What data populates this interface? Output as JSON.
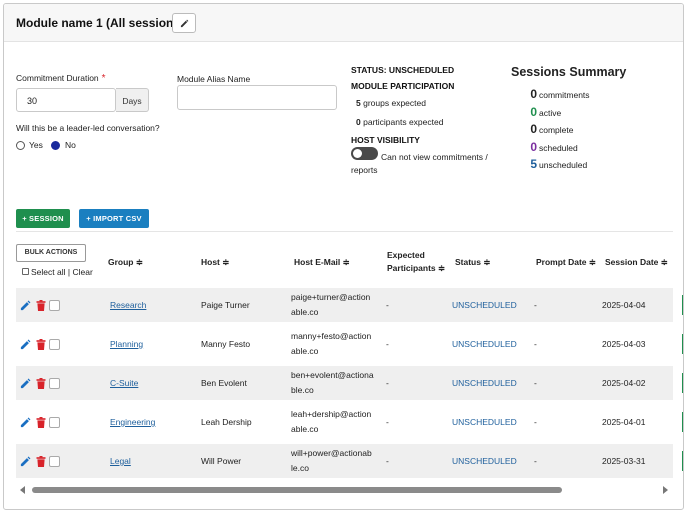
{
  "header": {
    "title": "Module name 1 (All sessions )"
  },
  "form": {
    "commitment_duration_label": "Commitment Duration",
    "required_mark": "*",
    "commitment_duration_value": "30",
    "days_label": "Days",
    "alias_label": "Module Alias Name",
    "alias_value": "",
    "leader_question": "Will this be a leader-led conversation?",
    "yes_label": "Yes",
    "no_label": "No",
    "leader_led_selected": "No"
  },
  "status_panel": {
    "status": "STATUS: UNSCHEDULED",
    "participation_title": "MODULE PARTICIPATION",
    "groups_count": "5",
    "groups_label": "groups expected",
    "participants_count": "0",
    "participants_label": "participants expected",
    "host_visibility_title": "HOST VISIBILITY",
    "host_visibility_line1": "Can not view commitments /",
    "host_visibility_line2": "reports",
    "host_visibility_on": false
  },
  "summary": {
    "title": "Sessions Summary",
    "items": [
      {
        "count": "0",
        "label": "commitments",
        "color": "#222222"
      },
      {
        "count": "0",
        "label": "active",
        "color": "#1f8f4e"
      },
      {
        "count": "0",
        "label": "complete",
        "color": "#222222"
      },
      {
        "count": "0",
        "label": "scheduled",
        "color": "#7b2fa0"
      },
      {
        "count": "5",
        "label": "unscheduled",
        "color": "#1e5f9c"
      }
    ]
  },
  "actions": {
    "add_session": "+ SESSION",
    "import_csv": "+ IMPORT CSV",
    "bulk_actions": "BULK ACTIONS",
    "select_all": "Select all",
    "separator": "|",
    "clear": "Clear"
  },
  "table": {
    "headers": {
      "group": "Group ≑",
      "host": "Host ≑",
      "host_email": "Host E-Mail ≑",
      "expected_line1": "Expected",
      "expected_line2": "Participants ≑",
      "status": "Status ≑",
      "prompt_date": "Prompt Date ≑",
      "session_date": "Session Date ≑"
    },
    "rows": [
      {
        "group": "Research",
        "host": "Paige Turner",
        "email_line1": "paige+turner@action",
        "email_line2": "able.co",
        "expected": "-",
        "status": "UNSCHEDULED",
        "prompt_date": "-",
        "session_date": "2025-04-04"
      },
      {
        "group": "Planning",
        "host": "Manny Festo",
        "email_line1": "manny+festo@action",
        "email_line2": "able.co",
        "expected": "-",
        "status": "UNSCHEDULED",
        "prompt_date": "-",
        "session_date": "2025-04-03"
      },
      {
        "group": "C-Suite",
        "host": "Ben Evolent",
        "email_line1": "ben+evolent@actiona",
        "email_line2": "ble.co",
        "expected": "-",
        "status": "UNSCHEDULED",
        "prompt_date": "-",
        "session_date": "2025-04-02"
      },
      {
        "group": "Engineering",
        "host": "Leah Dership",
        "email_line1": "leah+dership@action",
        "email_line2": "able.co",
        "expected": "-",
        "status": "UNSCHEDULED",
        "prompt_date": "-",
        "session_date": "2025-04-01"
      },
      {
        "group": "Legal",
        "host": "Will Power",
        "email_line1": "will+power@actionab",
        "email_line2": "le.co",
        "expected": "-",
        "status": "UNSCHEDULED",
        "prompt_date": "-",
        "session_date": "2025-03-31"
      }
    ]
  },
  "icons": {
    "edit": "pencil-icon",
    "delete": "trash-icon",
    "header_edit": "pencil-icon"
  },
  "colors": {
    "edit_icon": "#1a6fc2",
    "delete_icon": "#d8232a",
    "session_button": "#1f8f4e",
    "import_button": "#1a7fc0",
    "status_link": "#1e5f9c"
  }
}
